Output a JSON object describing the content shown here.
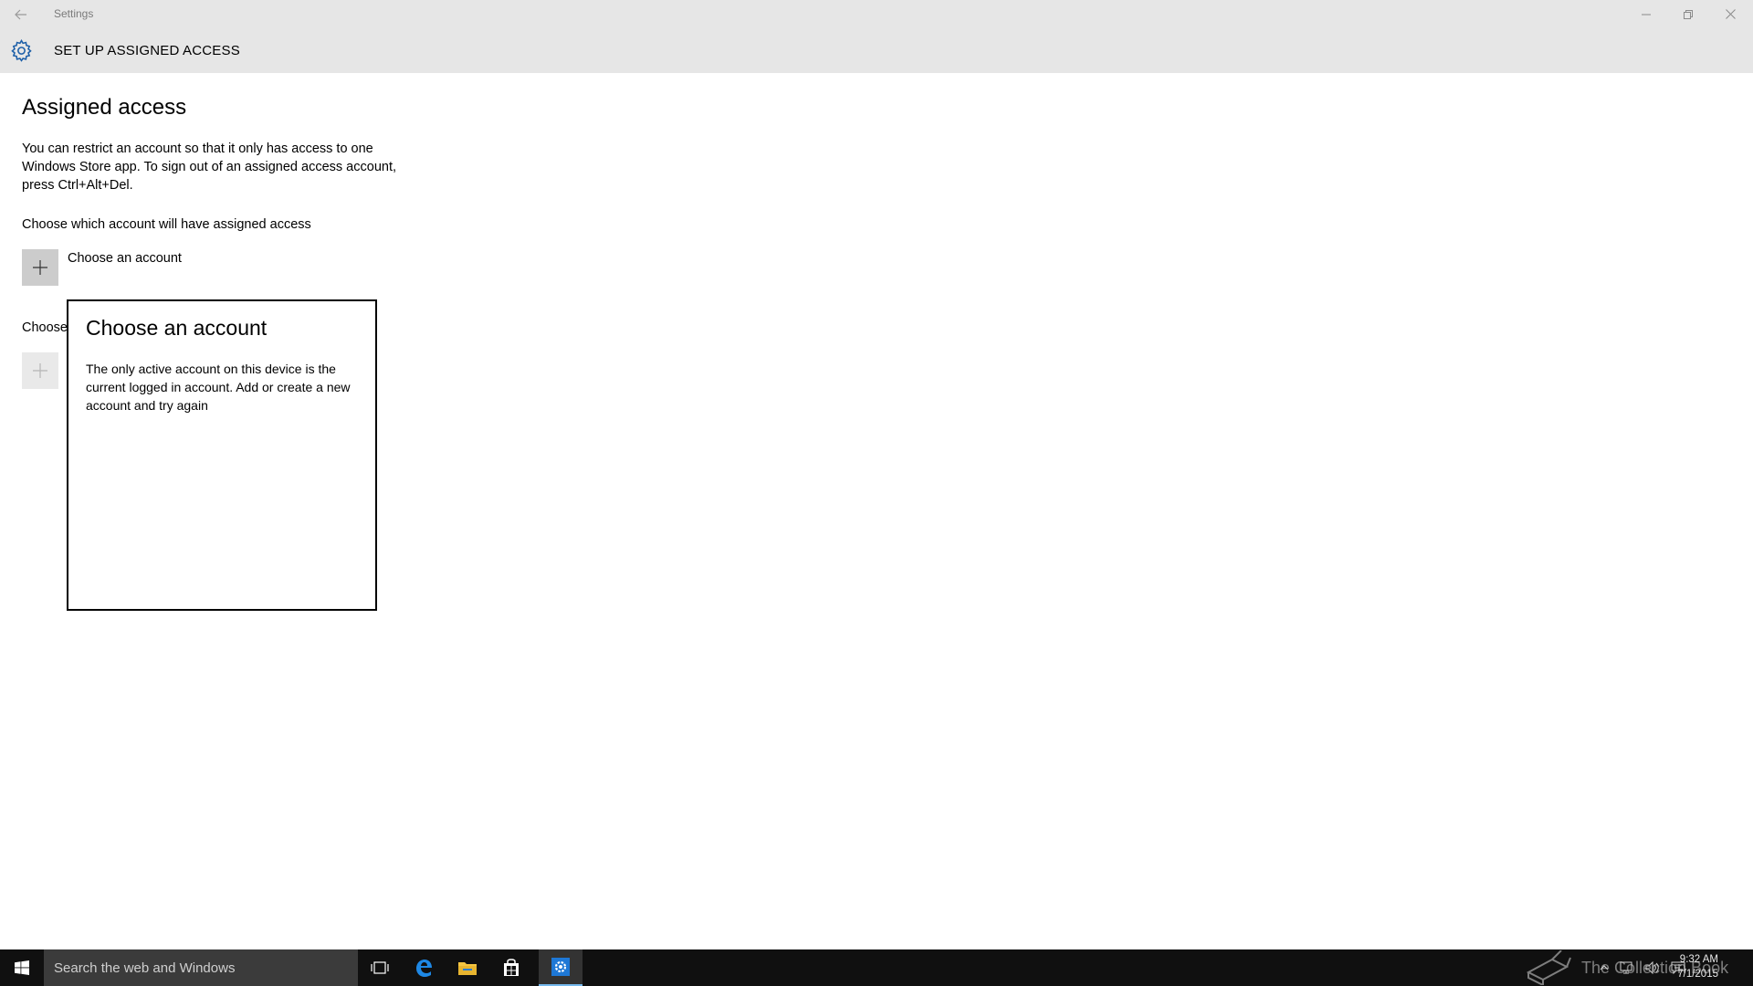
{
  "titlebar": {
    "app_title": "Settings",
    "back_icon": "back-arrow-icon",
    "minimize_icon": "minimize-icon",
    "restore_icon": "restore-icon",
    "close_icon": "close-icon"
  },
  "header": {
    "icon": "gear-icon",
    "title": "SET UP ASSIGNED ACCESS",
    "accent_color": "#1d5fa8"
  },
  "main": {
    "page_title": "Assigned access",
    "description": "You can restrict an account so that it only has access to one Windows Store app. To sign out of an assigned access account, press Ctrl+Alt+Del.",
    "account_section_label": "Choose which account will have assigned access",
    "account_tile_label": "Choose an account",
    "app_section_label": "Choose"
  },
  "flyout": {
    "title": "Choose an account",
    "message": "The only active account on this device is the current logged in account. Add or create a new account and try again"
  },
  "taskbar": {
    "search_placeholder": "Search the web and Windows",
    "icons": [
      "windows-start-icon",
      "task-view-icon",
      "edge-icon",
      "file-explorer-icon",
      "store-icon",
      "settings-icon"
    ],
    "watermark_text": "The Collection Book",
    "tray_icons": [
      "chevron-up-icon",
      "network-icon",
      "volume-icon",
      "action-center-icon"
    ],
    "time": "9:32 AM",
    "date": "7/1/2015",
    "active_color": "#76b9ed"
  }
}
